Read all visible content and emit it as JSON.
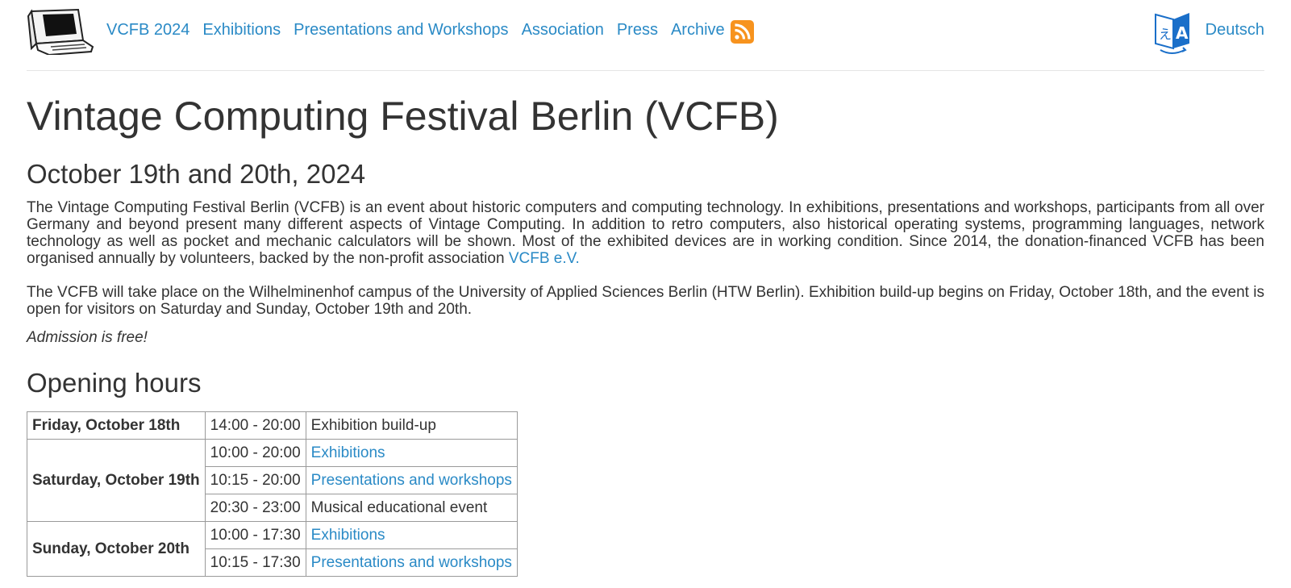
{
  "nav": {
    "items": [
      "VCFB 2024",
      "Exhibitions",
      "Presentations and Workshops",
      "Association",
      "Press",
      "Archive"
    ],
    "language_link": "Deutsch"
  },
  "icons": {
    "logo": "vintage-computer-logo",
    "feed": "rss-feed-icon",
    "language": "translate-icon"
  },
  "colors": {
    "link": "#2a8ac6",
    "rss": "#f7931e",
    "text": "#333333",
    "translate": "#1a6fc9"
  },
  "main": {
    "title": "Vintage Computing Festival Berlin (VCFB)",
    "date_heading": "October 19th and 20th, 2024",
    "intro": "The Vintage Computing Festival Berlin (VCFB) is an event about historic computers and computing technology. In exhibitions, presentations and workshops, participants from all over Germany and beyond present many different aspects of Vintage Computing. In addition to retro computers, also historical operating systems, programming languages, network technology as well as pocket and mechanic calculators will be shown. Most of the exhibited devices are in working condition. Since 2014, the donation-financed VCFB has been organised annually by volunteers, backed by the non-profit association ",
    "intro_link": "VCFB e.V.",
    "venue": "The VCFB will take place on the Wilhelminenhof campus of the University of Applied Sciences Berlin (HTW Berlin). Exhibition build-up begins on Friday, October 18th, and the event is open for visitors on Saturday and Sunday, October 19th and 20th.",
    "admission": "Admission is free!",
    "hours_heading": "Opening hours"
  },
  "schedule": {
    "days": [
      "Friday, October 18th",
      "Saturday, October 19th",
      "Sunday, October 20th"
    ],
    "rows": [
      {
        "time": "14:00 - 20:00",
        "event": "Exhibition build-up"
      },
      {
        "time": "10:00 - 20:00",
        "event": "Exhibitions"
      },
      {
        "time": "10:15 - 20:00",
        "event": "Presentations and workshops"
      },
      {
        "time": "20:30 - 23:00",
        "event": "Musical educational event"
      },
      {
        "time": "10:00 - 17:30",
        "event": "Exhibitions"
      },
      {
        "time": "10:15 - 17:30",
        "event": "Presentations and workshops"
      }
    ]
  }
}
